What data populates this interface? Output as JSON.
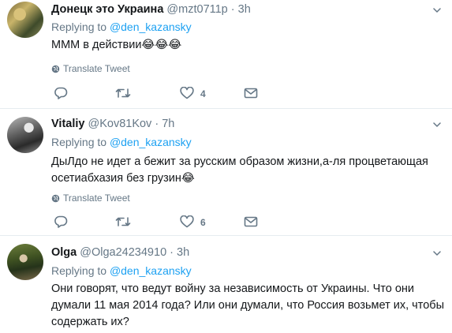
{
  "tweets": [
    {
      "name": "Донецк это Украина",
      "handle": "@mzt0711p",
      "dot": "·",
      "time": "3h",
      "replying_prefix": "Replying to",
      "replying_to": "@den_kazansky",
      "text": "МММ в действии😂😂😂",
      "translate": "Translate Tweet",
      "like_count": "4"
    },
    {
      "name": "Vitaliy",
      "handle": "@Kov81Kov",
      "dot": "·",
      "time": "7h",
      "replying_prefix": "Replying to",
      "replying_to": "@den_kazansky",
      "text": "ДыЛдо не идет а бежит за русским образом жизни,а-ля процветающая осетиабхазия без грузин😂",
      "translate": "Translate Tweet",
      "like_count": "6"
    },
    {
      "name": "Olga",
      "handle": "@Olga24234910",
      "dot": "·",
      "time": "3h",
      "replying_prefix": "Replying to",
      "replying_to": "@den_kazansky",
      "text": "Они говорят, что ведут войну за независимость от Украины. Что они думали 11 мая 2014 года? Или они думали, что Россия возьмет их, чтобы содержать их?"
    }
  ],
  "icons": {
    "reply": "reply-icon",
    "retweet": "retweet-icon",
    "like": "heart-icon",
    "dm": "direct-message-icon",
    "caret": "chevron-down-icon",
    "globe": "globe-icon"
  },
  "colors": {
    "link": "#1da1f2",
    "secondary": "#657786",
    "divider": "#e6ecf0"
  }
}
